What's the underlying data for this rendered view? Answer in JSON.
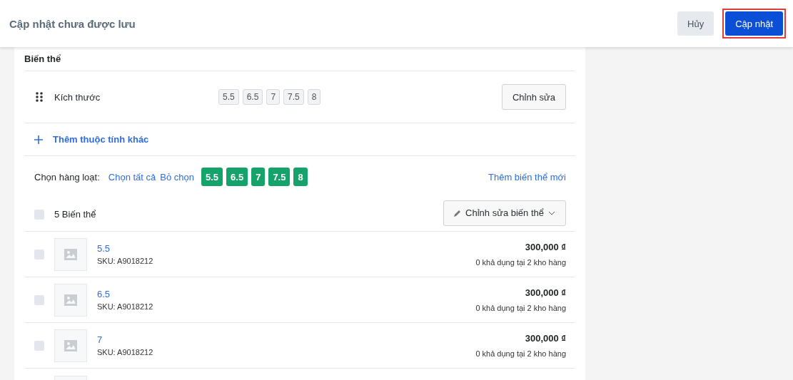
{
  "header": {
    "title": "Cập nhật chưa được lưu",
    "buttons": [
      {
        "label": "Hủy",
        "kind": "secondary",
        "highlighted": false
      },
      {
        "label": "Cập nhật",
        "kind": "primary",
        "highlighted": true
      }
    ]
  },
  "variants": {
    "title": "Biến thể",
    "attribute": {
      "name": "Kích thước",
      "values": [
        "5.5",
        "6.5",
        "7",
        "7.5",
        "8"
      ],
      "edit_button": "Chỉnh sửa"
    },
    "add_attribute": "Thêm thuộc tính khác",
    "bulk": {
      "label": "Chọn hàng loạt:",
      "select_all": "Chọn tất cả",
      "deselect": "Bỏ chọn",
      "add_variant": "Thêm biến thể mới",
      "chips": [
        {
          "label": "5.5",
          "selected": true
        },
        {
          "label": "6.5",
          "selected": true
        },
        {
          "label": "7",
          "selected": true
        },
        {
          "label": "7.5",
          "selected": true
        },
        {
          "label": "8",
          "selected": true
        }
      ]
    },
    "count": {
      "label": "5 Biến thể",
      "checked": false
    },
    "edit_variants": "Chỉnh sửa biến thể",
    "rows": [
      {
        "name": "5.5",
        "sku": "SKU: A9018212",
        "price": "300,000 ₫",
        "stock": "0 khả dụng tại 2 kho hàng",
        "checked": false
      },
      {
        "name": "6.5",
        "sku": "SKU: A9018212",
        "price": "300,000 ₫",
        "stock": "0 khả dụng tại 2 kho hàng",
        "checked": false
      },
      {
        "name": "7",
        "sku": "SKU: A9018212",
        "price": "300,000 ₫",
        "stock": "0 khả dụng tại 2 kho hàng",
        "checked": false
      }
    ]
  }
}
